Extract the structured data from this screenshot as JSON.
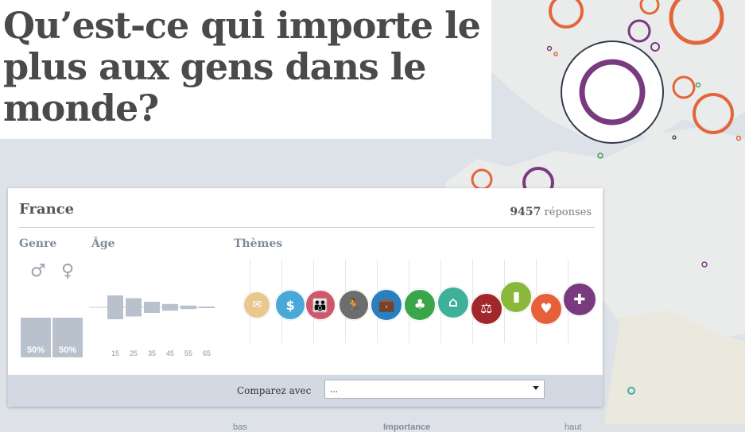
{
  "title": "Qu’est-ce qui importe le\nplus aux gens dans le\nmonde?",
  "panel": {
    "country": "France",
    "responses_count": "9457",
    "responses_label": "réponses",
    "genre_label": "Genre",
    "age_label": "Âge",
    "themes_label": "Thèmes"
  },
  "gender": {
    "male_symbol": "♂",
    "female_symbol": "♀",
    "male_pct_label": "50%",
    "female_pct_label": "50%",
    "male_fraction": 0.5,
    "female_fraction": 0.5,
    "bar_color": "#b9c1cd"
  },
  "chart_data": {
    "type": "bar",
    "title": "",
    "categories": [
      "15",
      "25",
      "35",
      "45",
      "55",
      "65"
    ],
    "values": [
      60,
      46,
      28,
      17,
      9,
      4
    ],
    "color": "#b9c1cd",
    "xlabel": "",
    "ylabel": ""
  },
  "themes": {
    "axis_low": "bas",
    "axis_mid": "Importance",
    "axis_high": "haut",
    "items": [
      {
        "icon": "envelope-icon",
        "glyph": "✉",
        "color": "#e8c88e",
        "importance": 0.02
      },
      {
        "icon": "money-icon",
        "glyph": "$",
        "color": "#4aa8d8",
        "importance": 0.12
      },
      {
        "icon": "people-icon",
        "glyph": "👪",
        "color": "#d0566a",
        "importance": 0.21
      },
      {
        "icon": "running-person-icon",
        "glyph": "🏃",
        "color": "#6d6d6d",
        "importance": 0.31
      },
      {
        "icon": "briefcase-icon",
        "glyph": "💼",
        "color": "#2a7fc0",
        "importance": 0.41
      },
      {
        "icon": "tree-icon",
        "glyph": "♣",
        "color": "#3aa64a",
        "importance": 0.51
      },
      {
        "icon": "house-icon",
        "glyph": "⌂",
        "color": "#3fb09a",
        "importance": 0.61
      },
      {
        "icon": "scales-icon",
        "glyph": "⚖",
        "color": "#a0282a",
        "importance": 0.71
      },
      {
        "icon": "book-icon",
        "glyph": "▮",
        "color": "#8ab83c",
        "importance": 0.8
      },
      {
        "icon": "heart-icon",
        "glyph": "♥",
        "color": "#e8603a",
        "importance": 0.89
      },
      {
        "icon": "health-cross-icon",
        "glyph": "✚",
        "color": "#7a3a80",
        "importance": 0.99
      }
    ]
  },
  "compare": {
    "label": "Comparez avec",
    "selected": "..."
  }
}
